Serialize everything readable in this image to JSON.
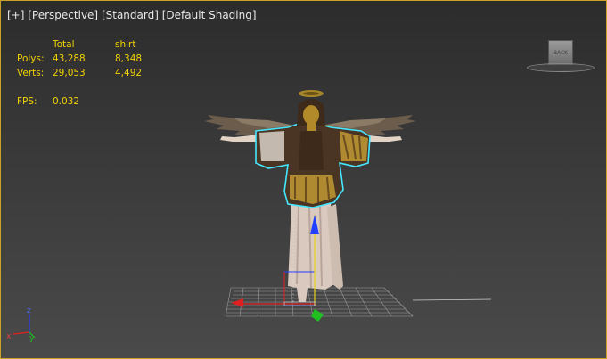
{
  "viewport": {
    "labels": [
      "[+]",
      "[Perspective]",
      "[Standard]",
      "[Default Shading]"
    ]
  },
  "stats": {
    "header": [
      "",
      "Total",
      "shirt"
    ],
    "rows": [
      {
        "label": "Polys:",
        "total": "43,288",
        "selected": "8,348"
      },
      {
        "label": "Verts:",
        "total": "29,053",
        "selected": "4,492"
      }
    ],
    "fps_label": "FPS:",
    "fps_value": "0.032"
  },
  "viewcube": {
    "face": "BACK"
  },
  "axis_tripod": {
    "z": "z",
    "x": "x",
    "y": "y"
  },
  "colors": {
    "stats_text": "#f2d300",
    "selection_outline": "#45e6ff",
    "axis_x": "#e02020",
    "axis_y": "#20c020",
    "axis_z": "#2040ff"
  }
}
